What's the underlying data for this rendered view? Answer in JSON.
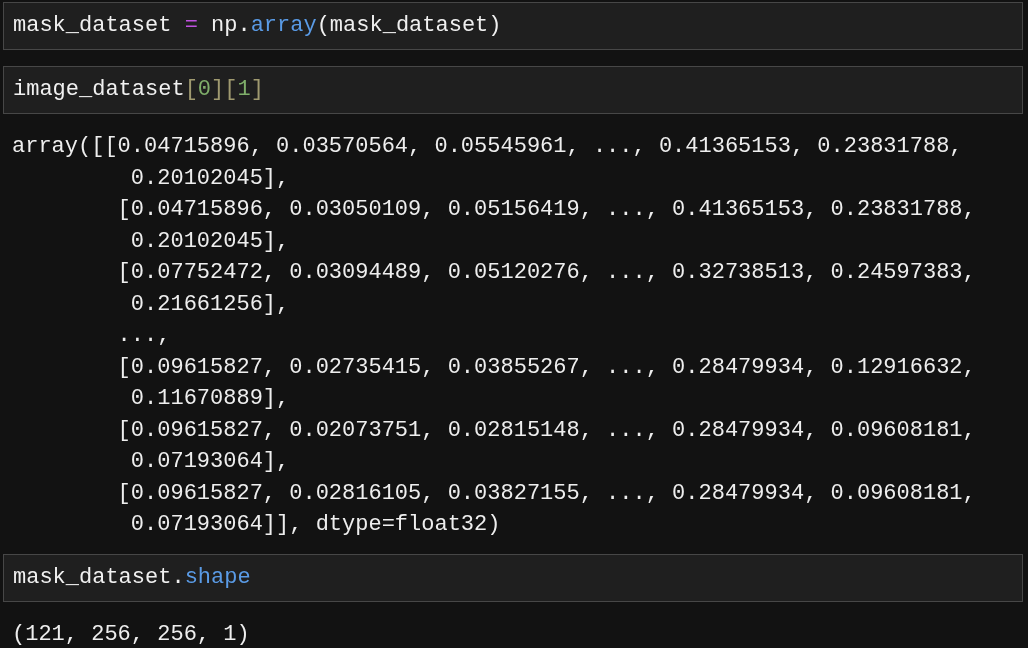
{
  "cells": [
    {
      "code": [
        {
          "kind": "plain",
          "text": "mask_dataset "
        },
        {
          "kind": "operator",
          "text": "="
        },
        {
          "kind": "plain",
          "text": " np."
        },
        {
          "kind": "call",
          "text": "array"
        },
        {
          "kind": "plain",
          "text": "(mask_dataset)"
        }
      ]
    },
    {
      "code": [
        {
          "kind": "plain",
          "text": "image_dataset"
        },
        {
          "kind": "bracket",
          "text": "["
        },
        {
          "kind": "number",
          "text": "0"
        },
        {
          "kind": "bracket",
          "text": "]["
        },
        {
          "kind": "number",
          "text": "1"
        },
        {
          "kind": "bracket",
          "text": "]"
        }
      ],
      "output": [
        "array([[0.04715896, 0.03570564, 0.05545961, ..., 0.41365153, 0.23831788,",
        "         0.20102045],",
        "        [0.04715896, 0.03050109, 0.05156419, ..., 0.41365153, 0.23831788,",
        "         0.20102045],",
        "        [0.07752472, 0.03094489, 0.05120276, ..., 0.32738513, 0.24597383,",
        "         0.21661256],",
        "        ...,",
        "        [0.09615827, 0.02735415, 0.03855267, ..., 0.28479934, 0.12916632,",
        "         0.11670889],",
        "        [0.09615827, 0.02073751, 0.02815148, ..., 0.28479934, 0.09608181,",
        "         0.07193064],",
        "        [0.09615827, 0.02816105, 0.03827155, ..., 0.28479934, 0.09608181,",
        "         0.07193064]], dtype=float32)"
      ]
    },
    {
      "code": [
        {
          "kind": "plain",
          "text": "mask_dataset."
        },
        {
          "kind": "attribute",
          "text": "shape"
        }
      ],
      "output": [
        "(121, 256, 256, 1)"
      ]
    }
  ]
}
